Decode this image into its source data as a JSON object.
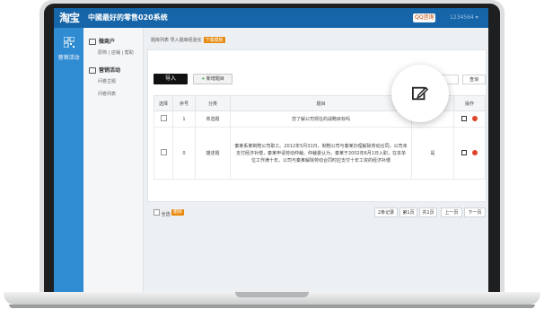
{
  "header": {
    "logo_text": "淘宝",
    "title": "中國最好的零售020系统",
    "qq_label": "QQ咨询",
    "user_label": "1234564"
  },
  "leftnav": {
    "label": "营销活动",
    "icon": "qr-code-icon"
  },
  "subnav": {
    "sections": [
      {
        "label": "微商户",
        "icon": "store-icon",
        "items": [
          "原简 | 店铺 | 帮助"
        ]
      },
      {
        "label": "营销活动",
        "icon": "calendar-icon",
        "items": [
          "问卷主题",
          "问卷列表"
        ]
      }
    ]
  },
  "breadcrumb": {
    "text": "题库列表 导入题库经验长",
    "badge": "下载模板"
  },
  "toolbar": {
    "import_label": "导入",
    "add_label": "新增题目",
    "search_placeholder": "",
    "search_button": "查询"
  },
  "table": {
    "headers": [
      "选择",
      "序号",
      "分类",
      "题目",
      "答案",
      "操作"
    ],
    "rows": [
      {
        "index": "1",
        "category": "单选题",
        "question": "您了解公司现在的战略目标吗",
        "answer": ""
      },
      {
        "index": "0",
        "category": "描述题",
        "question": "秦某系某制鞋公司职工。2012年5月31日，制鞋公司与秦某办理解除劳动合同，公司未支付经济补偿，秦某申请劳动仲裁。仲裁委认为，秦某于2002年6月1日入职，在本单位工作满十年。公司与秦某解除劳动合同时应支付十年工资的经济补偿",
        "answer": "是"
      }
    ]
  },
  "footer": {
    "select_all": "全选",
    "delete_label": "删除",
    "pagination": [
      "2条记录",
      "第1页",
      "共1页",
      "上一页",
      "下一页"
    ]
  },
  "magnifier": {
    "icon": "edit-icon"
  }
}
